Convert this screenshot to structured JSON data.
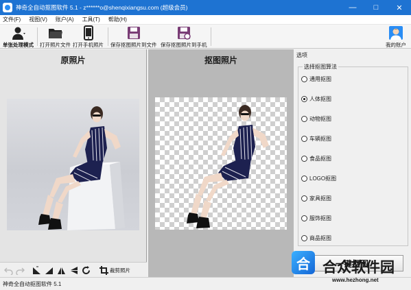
{
  "window": {
    "title": "神奇全自动抠图软件 5.1 - z******o@shenqixiangsu.com (超级会员)",
    "controls": [
      "—",
      "□",
      "✕"
    ]
  },
  "menu": [
    "文件(F)",
    "视图(V)",
    "账户(A)",
    "工具(T)",
    "帮助(H)"
  ],
  "toolbar": {
    "single_mode": "单张处理模式",
    "open_file": "打开照片文件",
    "open_phone": "打开手机照片",
    "save_file": "保存抠图照片到文件",
    "save_phone": "保存抠图照片到手机",
    "account": "我的账户"
  },
  "left_panel": {
    "title": "原照片",
    "crop_label": "裁剪照片"
  },
  "mid_panel": {
    "title": "抠图照片"
  },
  "options": {
    "header": "选项",
    "group_label": "选择抠图算法",
    "algorithms": [
      "通用抠图",
      "人体抠图",
      "动物抠图",
      "车辆抠图",
      "食品抠图",
      "LOGO抠图",
      "家具抠图",
      "服饰抠图",
      "商品抠图"
    ],
    "selected": "人体抠图",
    "action_button": "一键抠图"
  },
  "statusbar": {
    "text": "神奇全自动抠图软件 5.1"
  },
  "watermark": {
    "logo_char": "合",
    "text": "合众软件园",
    "url": "www.hezhong.net"
  },
  "colors": {
    "titlebar": "#1e73d2",
    "accent": "#2a8df4"
  }
}
